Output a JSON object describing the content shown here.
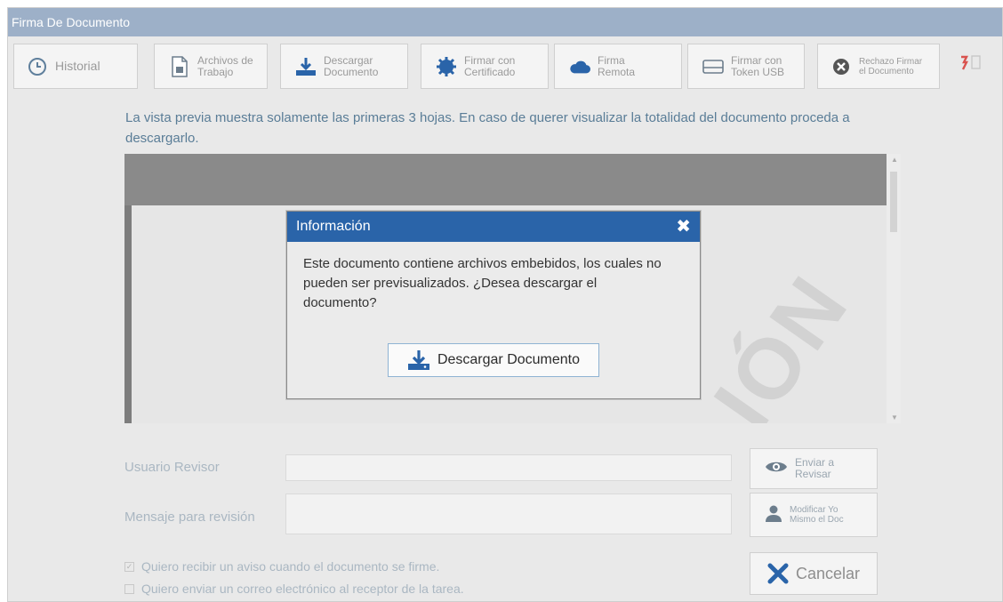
{
  "window": {
    "title": "Firma De Documento"
  },
  "toolbar": {
    "historial": "Historial",
    "archivos": [
      "Archivos de",
      "Trabajo"
    ],
    "descargar": [
      "Descargar",
      "Documento"
    ],
    "firmar_cert": [
      "Firmar con",
      "Certificado"
    ],
    "firma_remota": [
      "Firma",
      "Remota"
    ],
    "firmar_token": [
      "Firmar con",
      "Token USB"
    ],
    "rechazo": [
      "Rechazo Firmar",
      "el Documento"
    ]
  },
  "notice": "La vista previa muestra solamente las primeras 3 hojas. En caso de querer visualizar la totalidad del documento proceda a descargarlo.",
  "preview": {
    "watermark": "IÓN"
  },
  "modal": {
    "title": "Información",
    "close_icon": "close-icon",
    "message": "Este documento contiene archivos embebidos, los cuales no pueden ser previsualizados. ¿Desea descargar el documento?",
    "button_label": "Descargar Documento"
  },
  "form": {
    "usuario_revisor_label": "Usuario Revisor",
    "mensaje_label": "Mensaje para revisión",
    "usuario_revisor_value": "",
    "mensaje_value": "",
    "enviar_revisar": [
      "Enviar a",
      "Revisar"
    ],
    "modificar": [
      "Modificar Yo",
      "Mismo el Doc"
    ],
    "cancelar": "Cancelar",
    "aviso_firma": {
      "label": "Quiero recibir un aviso cuando el documento se firme.",
      "checked": true
    },
    "enviar_correo": {
      "label": "Quiero enviar un correo electrónico al receptor de la tarea.",
      "checked": false
    }
  },
  "colors": {
    "titlebar": "#9db0c8",
    "modal_header": "#2a64a9",
    "accent_blue": "#2a64a9",
    "cancel_x": "#2a64a9"
  }
}
